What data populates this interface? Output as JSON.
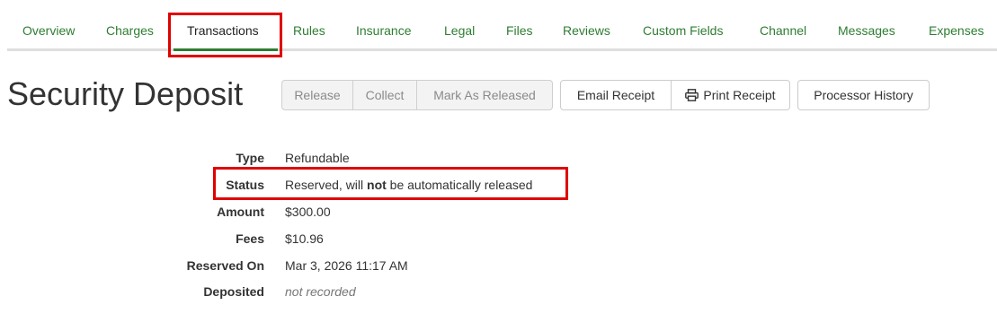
{
  "tabs": {
    "items": [
      {
        "label": "Overview"
      },
      {
        "label": "Charges"
      },
      {
        "label": "Transactions"
      },
      {
        "label": "Rules"
      },
      {
        "label": "Insurance"
      },
      {
        "label": "Legal"
      },
      {
        "label": "Files"
      },
      {
        "label": "Reviews"
      },
      {
        "label": "Custom Fields"
      },
      {
        "label": "Channel"
      },
      {
        "label": "Messages"
      },
      {
        "label": "Expenses"
      }
    ],
    "active": "Transactions"
  },
  "header": {
    "title": "Security Deposit"
  },
  "actions": {
    "release": "Release",
    "collect": "Collect",
    "mark_released": "Mark As Released",
    "email_receipt": "Email Receipt",
    "print_receipt": "Print Receipt",
    "processor_history": "Processor History"
  },
  "details": {
    "type": {
      "label": "Type",
      "value": "Refundable"
    },
    "status": {
      "label": "Status",
      "value_pre": "Reserved, will ",
      "value_bold": "not",
      "value_post": " be automatically released"
    },
    "amount": {
      "label": "Amount",
      "value": "$300.00"
    },
    "fees": {
      "label": "Fees",
      "value": "$10.96"
    },
    "reserved_on": {
      "label": "Reserved On",
      "value": "Mar 3, 2026 11:17 AM"
    },
    "deposited": {
      "label": "Deposited",
      "value": "not recorded"
    }
  },
  "colors": {
    "tab_link": "#2e7d32",
    "highlight": "#e00000"
  },
  "icons": {
    "print": "printer-icon"
  }
}
